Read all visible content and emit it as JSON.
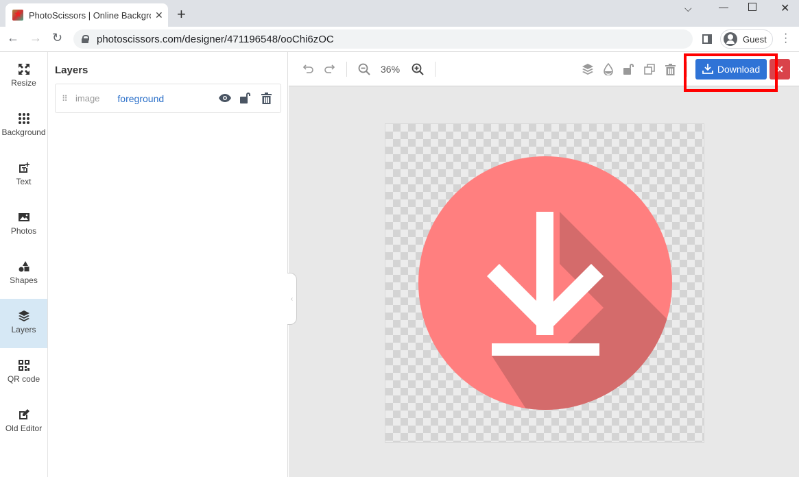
{
  "browser": {
    "tab_title": "PhotoScissors | Online Backgro",
    "url": "photoscissors.com/designer/471196548/ooChi6zOC",
    "profile_name": "Guest"
  },
  "rail": {
    "items": [
      {
        "label": "Resize",
        "icon": "resize-icon"
      },
      {
        "label": "Background",
        "icon": "dots-grid-icon"
      },
      {
        "label": "Text",
        "icon": "text-add-icon"
      },
      {
        "label": "Photos",
        "icon": "image-icon"
      },
      {
        "label": "Shapes",
        "icon": "shapes-icon"
      },
      {
        "label": "Layers",
        "icon": "layers-icon",
        "active": true
      },
      {
        "label": "QR code",
        "icon": "qr-code-icon"
      },
      {
        "label": "Old Editor",
        "icon": "edit-icon"
      }
    ]
  },
  "panel": {
    "title": "Layers",
    "layers": [
      {
        "type": "image",
        "name": "foreground"
      }
    ]
  },
  "editor": {
    "zoom": "36%",
    "download_label": "Download",
    "close_label": "✕"
  },
  "colors": {
    "accent_blue": "#2f73d6",
    "danger_red": "#d9434a",
    "highlight_red": "#ff0000",
    "circle_pink": "#ff7f7f",
    "shadow_pink": "#d46b6b"
  }
}
